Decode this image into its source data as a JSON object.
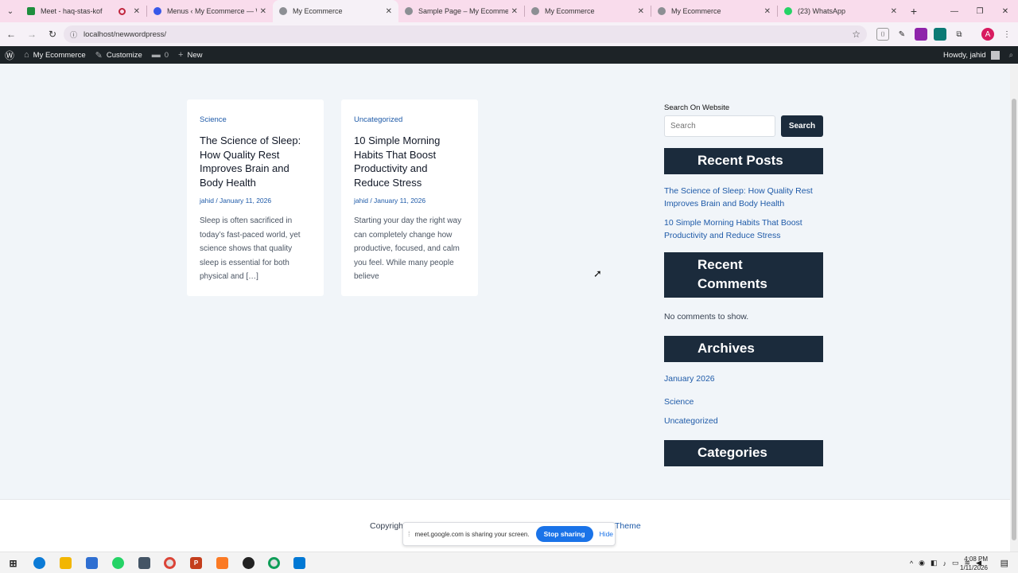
{
  "browser": {
    "tabs": [
      {
        "label": "Meet - haq-stas-kof",
        "favicon_color": "#1e8e3e",
        "recording": true
      },
      {
        "label": "Menus ‹ My Ecommerce — W",
        "favicon_color": "#3858e9"
      },
      {
        "label": "My Ecommerce",
        "favicon_color": "#8c8f94",
        "active": true
      },
      {
        "label": "Sample Page – My Ecommerce",
        "favicon_color": "#8c8f94"
      },
      {
        "label": "My Ecommerce",
        "favicon_color": "#8c8f94"
      },
      {
        "label": "My Ecommerce",
        "favicon_color": "#8c8f94"
      },
      {
        "label": "(23) WhatsApp",
        "favicon_color": "#25d366"
      }
    ],
    "url": "localhost/newwordpress/",
    "profile_initial": "A"
  },
  "adminbar": {
    "site_name": "My Ecommerce",
    "customize": "Customize",
    "comments_count": "0",
    "new": "New",
    "howdy": "Howdy, jahid"
  },
  "posts": [
    {
      "category": "Science",
      "title": "The Science of Sleep: How Quality Rest Improves Brain and Body Health",
      "meta": "jahid / January 11, 2026",
      "excerpt": "Sleep is often sacrificed in today’s fast-paced world, yet science shows that quality sleep is essential for both physical and […]"
    },
    {
      "category": "Uncategorized",
      "title": "10 Simple Morning Habits That Boost Productivity and Reduce Stress",
      "meta": "jahid / January 11, 2026",
      "excerpt": "Starting your day the right way can completely change how productive, focused, and calm you feel. While many people believe"
    }
  ],
  "sidebar": {
    "search_label": "Search On Website",
    "search_placeholder": "Search",
    "search_button": "Search",
    "recent_posts_title": "Recent Posts",
    "recent_posts": [
      "The Science of Sleep: How Quality Rest Improves Brain and Body Health",
      "10 Simple Morning Habits That Boost Productivity and Reduce Stress"
    ],
    "recent_comments_title": "Recent Comments",
    "no_comments": "No comments to show.",
    "archives_title": "Archives",
    "archives": [
      "January 2026"
    ],
    "categories_list": [
      "Science",
      "Uncategorized"
    ],
    "categories_title": "Categories"
  },
  "footer": {
    "copyright": "Copyrigh",
    "theme": "Theme"
  },
  "share_bar": {
    "message": "meet.google.com is sharing your screen.",
    "stop": "Stop sharing",
    "hide": "Hide"
  },
  "taskbar": {
    "time": "4:08 PM",
    "date": "1/11/2026"
  }
}
